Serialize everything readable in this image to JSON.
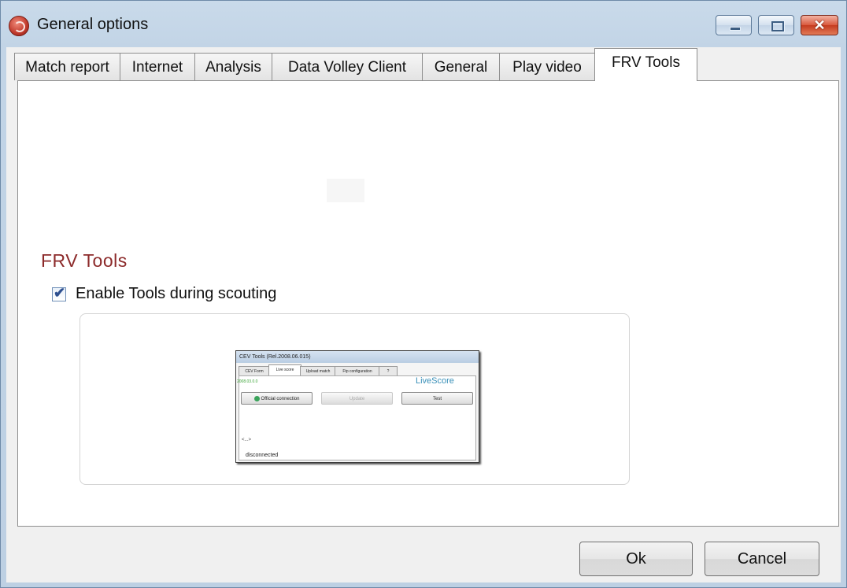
{
  "window": {
    "title": "General options",
    "controls": {
      "minimize": "–",
      "maximize": "□",
      "close": "✕"
    }
  },
  "tabs": [
    {
      "label": "Match report",
      "active": false
    },
    {
      "label": "Internet",
      "active": false
    },
    {
      "label": "Analysis",
      "active": false
    },
    {
      "label": "Data Volley Client",
      "active": false
    },
    {
      "label": "General",
      "active": false
    },
    {
      "label": "Play video",
      "active": false
    },
    {
      "label": "FRV Tools",
      "active": true
    }
  ],
  "panel": {
    "section_title": "FRV Tools",
    "enable_checkbox": {
      "label": "Enable Tools during scouting",
      "checked": true,
      "checkmark": "✔"
    }
  },
  "preview": {
    "title": "CEV Tools  (Rel.2008.06.015)",
    "tabs": [
      "CEV Form",
      "Live score",
      "Upload match",
      "Ftp configuration",
      "?"
    ],
    "version": "2008.03.0.0",
    "livescore": "LiveScore",
    "buttons": {
      "official": "Official connection",
      "update": "Update",
      "test": "Test"
    },
    "ellipsis": "<...>",
    "status": "disconnected"
  },
  "footer": {
    "ok_label": "Ok",
    "cancel_label": "Cancel"
  },
  "colors": {
    "section_title": "#8c2a2a",
    "window_frame": "#c2d4e6",
    "close_button": "#c53b1f"
  }
}
